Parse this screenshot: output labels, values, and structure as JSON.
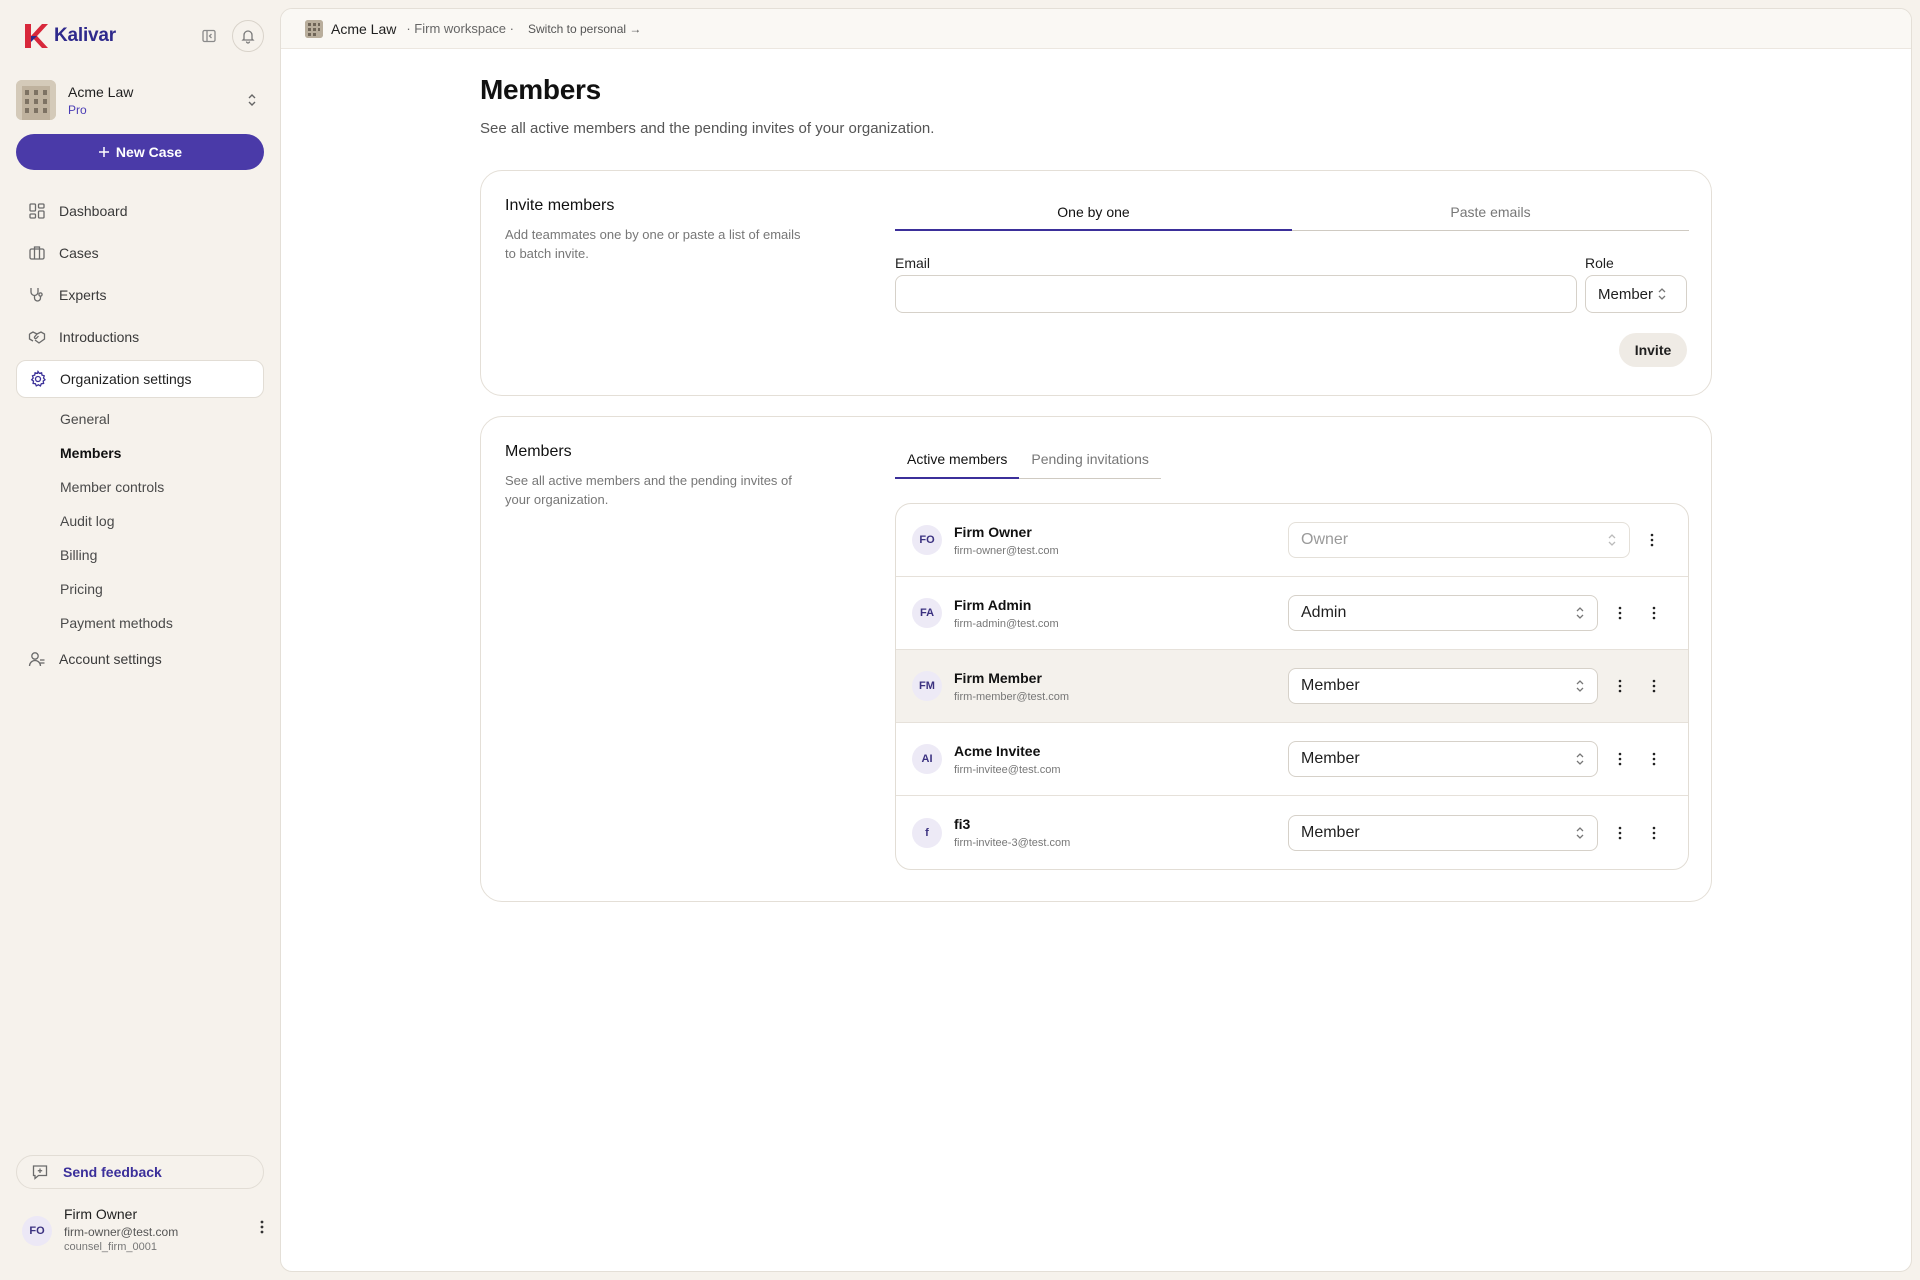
{
  "brand": {
    "name": "Kalivar",
    "accent": "#4a3aa8",
    "logo_color": "#d8283b"
  },
  "sidebar": {
    "org": {
      "name": "Acme Law",
      "plan": "Pro"
    },
    "new_case_label": "New Case",
    "nav": [
      {
        "label": "Dashboard",
        "icon": "dashboard-icon"
      },
      {
        "label": "Cases",
        "icon": "briefcase-icon"
      },
      {
        "label": "Experts",
        "icon": "stethoscope-icon"
      },
      {
        "label": "Introductions",
        "icon": "handshake-icon"
      },
      {
        "label": "Organization settings",
        "icon": "gear-icon"
      }
    ],
    "subnav": [
      "General",
      "Members",
      "Member controls",
      "Audit log",
      "Billing",
      "Pricing",
      "Payment methods"
    ],
    "account_settings": {
      "label": "Account settings",
      "icon": "user-icon"
    },
    "feedback_label": "Send feedback",
    "user": {
      "initials": "FO",
      "name": "Firm Owner",
      "email": "firm-owner@test.com",
      "handle": "counsel_firm_0001"
    }
  },
  "topbar": {
    "org": "Acme Law",
    "workspace": "· Firm workspace ·",
    "switch": "Switch to personal →"
  },
  "page": {
    "title": "Members",
    "subtitle": "See all active members and the pending invites of your organization."
  },
  "invite": {
    "title": "Invite members",
    "description": "Add teammates one by one or paste a list of emails to batch invite.",
    "tabs": [
      "One by one",
      "Paste emails"
    ],
    "email_label": "Email",
    "email_value": "",
    "role_label": "Role",
    "role_value": "Member",
    "invite_label": "Invite"
  },
  "members": {
    "title": "Members",
    "description": "See all active members and the pending invites of your organization.",
    "tabs": [
      "Active members",
      "Pending invitations"
    ],
    "rows": [
      {
        "initials": "FO",
        "name": "Firm Owner",
        "email": "firm-owner@test.com",
        "role": "Owner"
      },
      {
        "initials": "FA",
        "name": "Firm Admin",
        "email": "firm-admin@test.com",
        "role": "Admin"
      },
      {
        "initials": "FM",
        "name": "Firm Member",
        "email": "firm-member@test.com",
        "role": "Member"
      },
      {
        "initials": "AI",
        "name": "Acme Invitee",
        "email": "firm-invitee@test.com",
        "role": "Member"
      },
      {
        "initials": "f",
        "name": "fi3",
        "email": "firm-invitee-3@test.com",
        "role": "Member"
      }
    ]
  }
}
